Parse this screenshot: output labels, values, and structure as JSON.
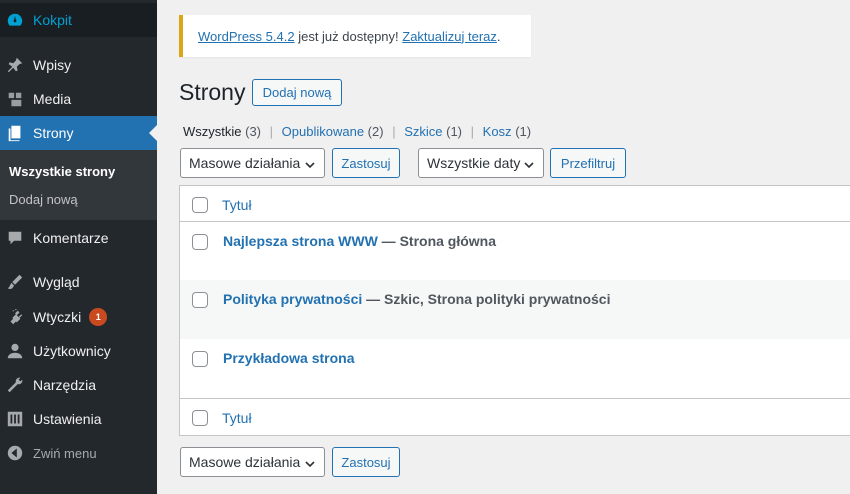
{
  "sidebar": {
    "items": [
      {
        "label": "Kokpit",
        "icon": "dashboard-icon"
      },
      {
        "label": "Wpisy",
        "icon": "pin-icon"
      },
      {
        "label": "Media",
        "icon": "media-icon"
      },
      {
        "label": "Strony",
        "icon": "pages-icon"
      },
      {
        "label": "Komentarze",
        "icon": "comment-icon"
      },
      {
        "label": "Wygląd",
        "icon": "brush-icon"
      },
      {
        "label": "Wtyczki",
        "icon": "plugin-icon",
        "badge": "1"
      },
      {
        "label": "Użytkownicy",
        "icon": "user-icon"
      },
      {
        "label": "Narzędzia",
        "icon": "wrench-icon"
      },
      {
        "label": "Ustawienia",
        "icon": "settings-icon"
      },
      {
        "label": "Zwiń menu",
        "icon": "collapse-icon"
      }
    ],
    "submenu": {
      "all_pages": "Wszystkie strony",
      "add_new": "Dodaj nową"
    }
  },
  "notice": {
    "link_version": "WordPress 5.4.2",
    "text": " jest już dostępny! ",
    "link_update": "Zaktualizuj teraz",
    "period": "."
  },
  "page": {
    "title": "Strony",
    "add_new_label": "Dodaj nową"
  },
  "filters": [
    {
      "label": "Wszystkie",
      "count": "(3)"
    },
    {
      "label": "Opublikowane",
      "count": "(2)"
    },
    {
      "label": "Szkice",
      "count": "(1)"
    },
    {
      "label": "Kosz",
      "count": "(1)"
    }
  ],
  "bulk_actions": {
    "select": "Masowe działania",
    "apply": "Zastosuj"
  },
  "dates": {
    "select": "Wszystkie daty",
    "filter": "Przefiltruj"
  },
  "table": {
    "column_title": "Tytuł",
    "rows": [
      {
        "title": "Najlepsza strona WWW",
        "state": " — Strona główna"
      },
      {
        "title": "Polityka prywatności",
        "state": " — Szkic, Strona polityki prywatności"
      },
      {
        "title": "Przykładowa strona",
        "state": ""
      }
    ]
  },
  "colors": {
    "sidebar_bg": "#23282d",
    "accent": "#2271b1",
    "notice_border": "#dba617",
    "badge": "#ca4a1f"
  }
}
